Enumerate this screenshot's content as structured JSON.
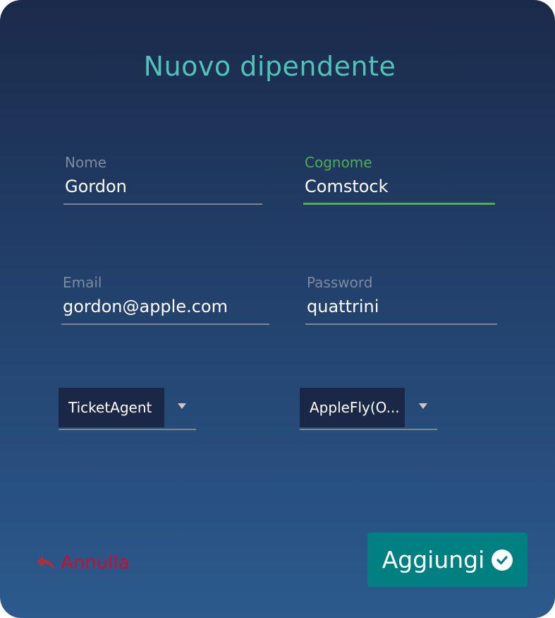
{
  "dialog": {
    "title": "Nuovo dipendente"
  },
  "form": {
    "nome": {
      "label": "Nome",
      "value": "Gordon"
    },
    "cognome": {
      "label": "Cognome",
      "value": "Comstock",
      "focused": true
    },
    "email": {
      "label": "Email",
      "value": "gordon@apple.com"
    },
    "password": {
      "label": "Password",
      "value": "quattrini"
    },
    "role_select": {
      "selected": "TicketAgent"
    },
    "company_select": {
      "selected": "AppleFly(O..."
    }
  },
  "actions": {
    "cancel_label": "Annulla",
    "add_label": "Aggiungi"
  },
  "colors": {
    "accent_teal": "#4fc3b8",
    "focus_green": "#4caf50",
    "button_bg": "#008080",
    "cancel_red": "#c8102e"
  },
  "icons": {
    "cancel": "undo-arrow-icon",
    "add": "check-circle-icon",
    "dropdown": "triangle-down-icon"
  }
}
